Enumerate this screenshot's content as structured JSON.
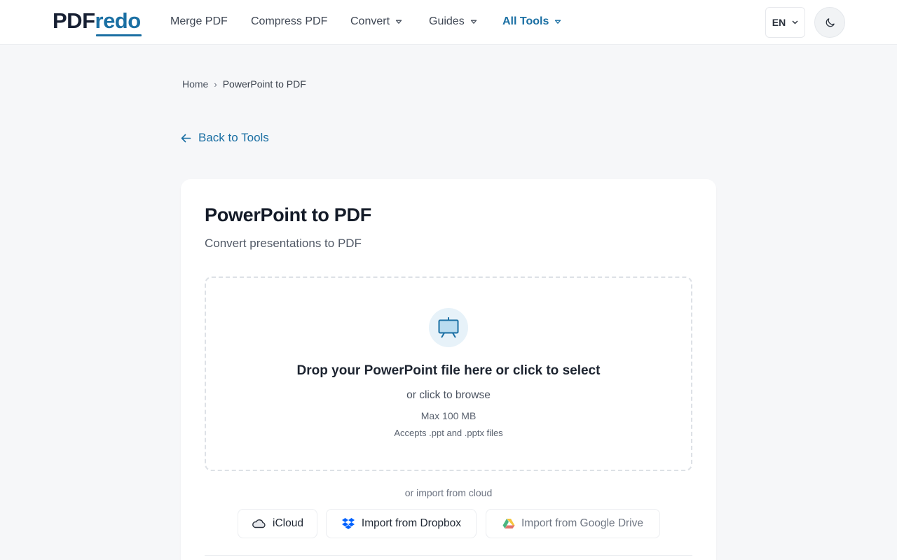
{
  "header": {
    "logo_part1": "PDF",
    "logo_part2": "redo",
    "nav": [
      {
        "label": "Merge PDF"
      },
      {
        "label": "Compress PDF"
      },
      {
        "label": "Convert"
      },
      {
        "label": "Guides"
      },
      {
        "label": "All Tools"
      }
    ],
    "language": "EN",
    "theme_icon": "moon-icon",
    "colors": {
      "brand_dark": "#172033",
      "brand_accent": "#1a6fa3"
    }
  },
  "breadcrumb": {
    "home": "Home",
    "separator": "›",
    "current": "PowerPoint to PDF"
  },
  "back_link": {
    "label": "Back to Tools",
    "icon": "arrow-left-icon"
  },
  "tool": {
    "title": "PowerPoint to PDF",
    "subtitle": "Convert presentations to PDF",
    "dropzone": {
      "icon": "presentation-icon",
      "title": "Drop your PowerPoint file here or click to select",
      "browse_hint": "or click to browse",
      "max_size": "Max 100 MB",
      "accepts": "Accepts .ppt and .pptx files"
    },
    "cloud": {
      "caption": "or import from cloud",
      "buttons": [
        {
          "label": "iCloud",
          "icon": "cloud-icon"
        },
        {
          "label": "Import from Dropbox",
          "icon": "dropbox-icon"
        },
        {
          "label": "Import from Google Drive",
          "icon": "google-drive-icon"
        }
      ]
    }
  }
}
